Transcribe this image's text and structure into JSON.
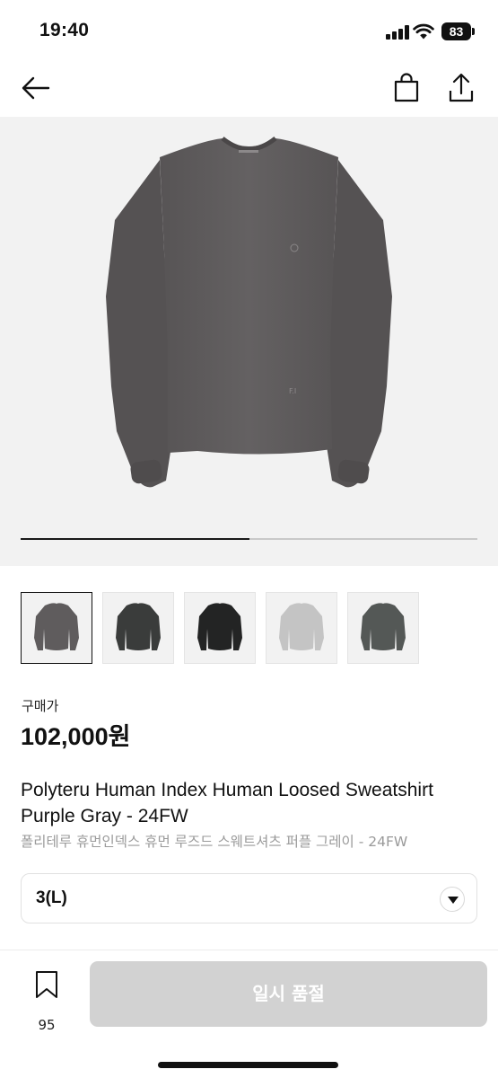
{
  "status_bar": {
    "time": "19:40",
    "battery": "83"
  },
  "nav": {
    "icons": [
      "back-arrow-icon",
      "shopping-bag-icon",
      "share-icon"
    ]
  },
  "gallery": {
    "image_count": 5,
    "progress_fraction": 0.5,
    "thumbnails": [
      {
        "color": "#5f5c5d",
        "selected": true
      },
      {
        "color": "#3a3c3b",
        "selected": false
      },
      {
        "color": "#232424",
        "selected": false
      },
      {
        "color": "#c4c4c4",
        "selected": false
      },
      {
        "color": "#545856",
        "selected": false
      }
    ]
  },
  "product": {
    "price_label": "구매가",
    "price": "102,000원",
    "title_en": "Polyteru Human Index Human Loosed Sweatshirt Purple Gray - 24FW",
    "title_ko": "폴리테루 휴먼인덱스 휴먼 루즈드 스웨트셔츠 퍼플 그레이 - 24FW"
  },
  "size_select": {
    "value": "3(L)"
  },
  "bottom": {
    "bookmark_count": "95",
    "buy_label": "일시 품절"
  },
  "colors": {
    "hero_bg": "#f2f2f2",
    "disabled_button": "#d2d2d2"
  }
}
